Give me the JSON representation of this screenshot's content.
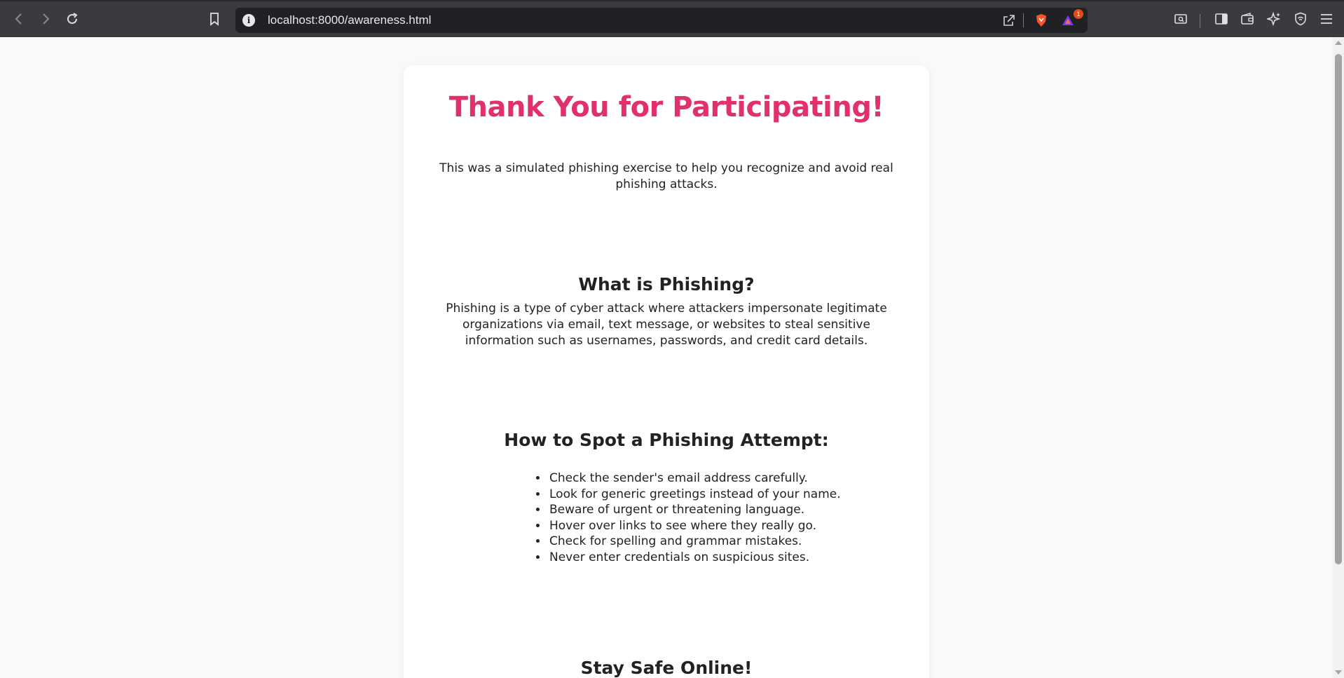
{
  "browser": {
    "url": "localhost:8000/awareness.html",
    "info_glyph": "i",
    "shields_badge": "1",
    "icons": [
      "back-icon",
      "forward-icon",
      "reload-icon",
      "bookmark-icon",
      "info-icon",
      "share-icon",
      "brave-shields-icon",
      "brave-rewards-icon",
      "reader-mode-icon",
      "sidebar-icon",
      "wallet-icon",
      "leo-ai-icon",
      "vpn-icon",
      "menu-icon"
    ]
  },
  "page": {
    "title": "Thank You for Participating!",
    "intro": "This was a simulated phishing exercise to help you recognize and avoid real phishing attacks.",
    "what_heading": "What is Phishing?",
    "what_text": "Phishing is a type of cyber attack where attackers impersonate legitimate organizations via email, text message, or websites to steal sensitive information such as usernames, passwords, and credit card details.",
    "spot_heading": "How to Spot a Phishing Attempt:",
    "tips": [
      "Check the sender's email address carefully.",
      "Look for generic greetings instead of your name.",
      "Beware of urgent or threatening language.",
      "Hover over links to see where they really go.",
      "Check for spelling and grammar mistakes.",
      "Never enter credentials on suspicious sites."
    ],
    "safe_heading": "Stay Safe Online!"
  },
  "colors": {
    "title": "#e0306d",
    "toolbar": "#3b3b3f",
    "urlbar": "#202124",
    "page_bg": "#f9f9f9",
    "card_bg": "#ffffff"
  }
}
